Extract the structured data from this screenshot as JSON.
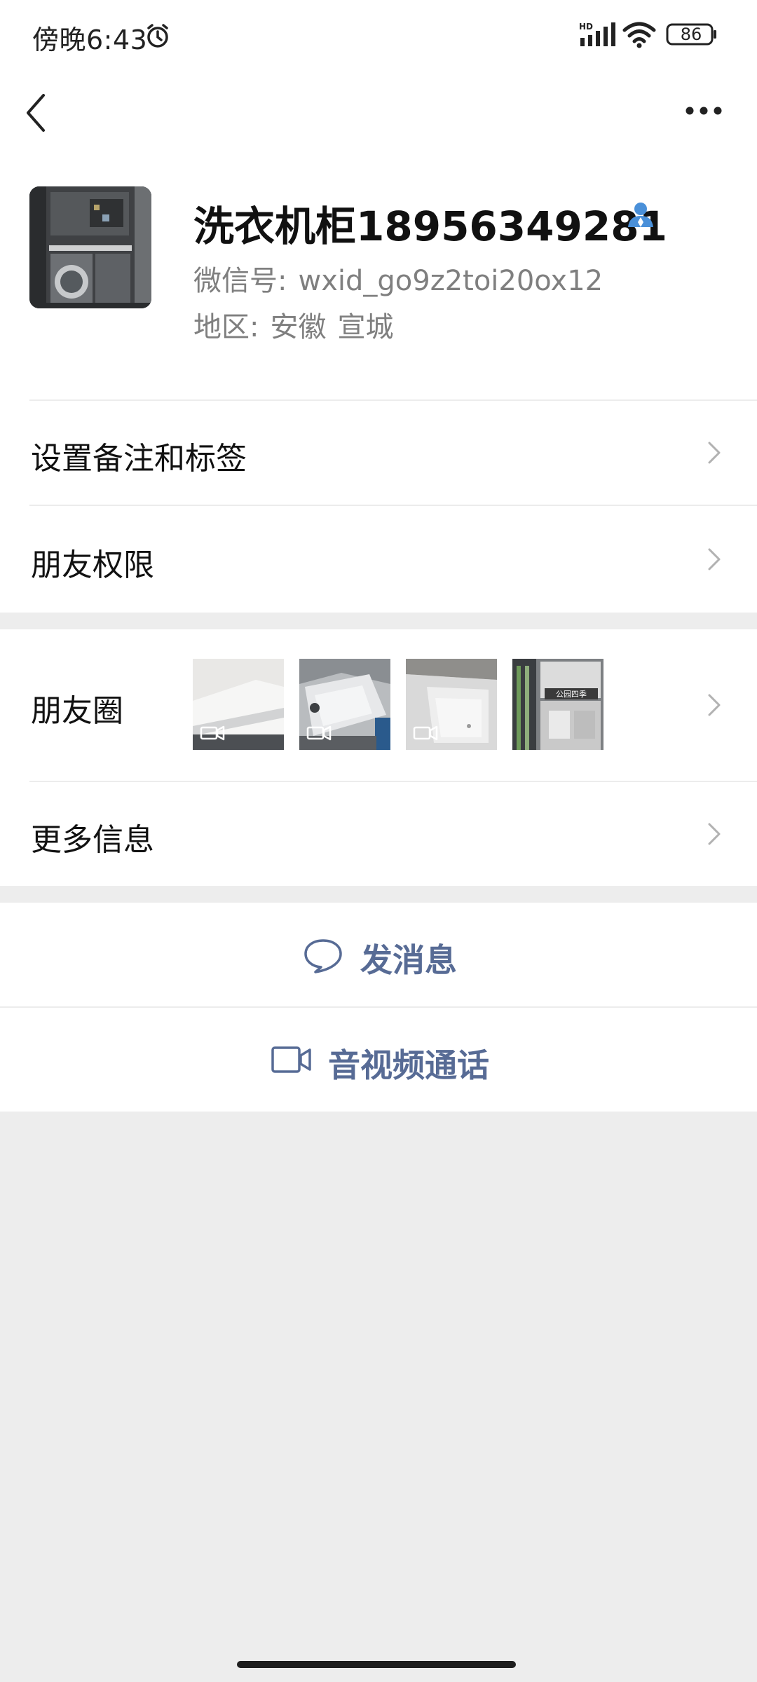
{
  "status_bar": {
    "time": "傍晚6:43",
    "network": "HD",
    "battery": "86"
  },
  "profile": {
    "name": "洗衣机柜18956349281",
    "wechat_id_label": "微信号:",
    "wechat_id": "wxid_go9z2toi20ox12",
    "region_label": "地区:",
    "region_province": "安徽",
    "region_city": "宣城"
  },
  "menu": {
    "remark_tags": "设置备注和标签",
    "friend_permissions": "朋友权限",
    "moments": "朋友圈",
    "more_info": "更多信息"
  },
  "moments_thumbs": [
    {
      "kind": "video"
    },
    {
      "kind": "video"
    },
    {
      "kind": "video"
    },
    {
      "kind": "image",
      "caption": "公园四季"
    }
  ],
  "actions": {
    "send_message": "发消息",
    "av_call": "音视频通话"
  },
  "colors": {
    "link": "#576b95",
    "background": "#ededed",
    "contact_badge": "#4a90d9"
  }
}
